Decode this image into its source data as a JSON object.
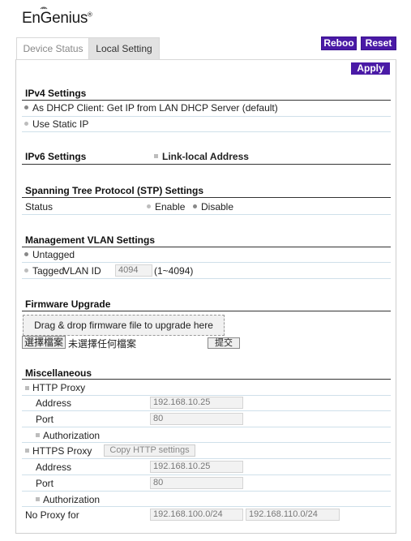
{
  "brand": {
    "logo_text": "EnGenius",
    "reg_mark": "®"
  },
  "tabs": [
    {
      "label": "Device Status"
    },
    {
      "label": "Local Setting"
    }
  ],
  "top_buttons": {
    "reboot": "Reboo",
    "reset": "Reset"
  },
  "apply_label": "Apply",
  "ipv4": {
    "title": "IPv4 Settings",
    "options": [
      "As DHCP Client: Get IP from LAN DHCP Server (default)",
      "Use Static IP"
    ],
    "selected": 0
  },
  "ipv6": {
    "title": "IPv6 Settings",
    "option": "Link-local Address",
    "checked": true
  },
  "stp": {
    "title": "Spanning Tree Protocol (STP) Settings",
    "status_label": "Status",
    "enable": "Enable",
    "disable": "Disable",
    "selected": "disable"
  },
  "vlan": {
    "title": "Management VLAN Settings",
    "untagged": "Untagged",
    "tagged": "Tagged",
    "vlan_id_label": "VLAN ID",
    "vlan_id_value": "4094",
    "range": "(1~4094)",
    "selected": "untagged"
  },
  "firmware": {
    "title": "Firmware Upgrade",
    "drop_text": "Drag & drop firmware file to upgrade here",
    "choose_file": "選擇檔案",
    "no_file": "未選擇任何檔案",
    "submit": "提交"
  },
  "misc": {
    "title": "Miscellaneous",
    "http_proxy": "HTTP Proxy",
    "https_proxy": "HTTPS Proxy",
    "copy_http": "Copy HTTP settings",
    "address_label": "Address",
    "port_label": "Port",
    "authorization": "Authorization",
    "http_address": "192.168.10.25",
    "http_port": "80",
    "https_address": "192.168.10.25",
    "https_port": "80",
    "no_proxy_label": "No Proxy for",
    "no_proxy_1": "192.168.100.0/24",
    "no_proxy_2": "192.168.110.0/24"
  },
  "colors": {
    "accent": "#4a1aa6",
    "divider": "#333333",
    "row_line": "#cfe0ea"
  }
}
